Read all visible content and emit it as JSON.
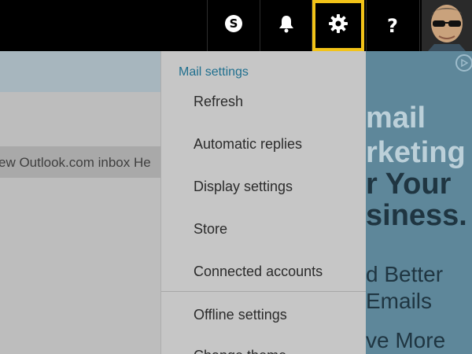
{
  "topbar": {
    "skype_icon": "skype-icon",
    "bell_icon": "bell-icon",
    "gear_icon": "gear-icon",
    "help_label": "?"
  },
  "inbox": {
    "preview_text": "ew Outlook.com inbox He"
  },
  "settings_menu": {
    "header": "Mail settings",
    "items": [
      "Refresh",
      "Automatic replies",
      "Display settings",
      "Store",
      "Connected accounts",
      "Offline settings",
      "Change theme"
    ]
  },
  "ad": {
    "lines": [
      "mail",
      "rketing",
      "r Your",
      "siness.",
      "d Better",
      "Emails",
      "ve More"
    ]
  },
  "colors": {
    "topbar": "#000000",
    "highlight": "#f2c318",
    "menu_header": "#1f6f8e",
    "ad_bg": "#5e879a"
  }
}
